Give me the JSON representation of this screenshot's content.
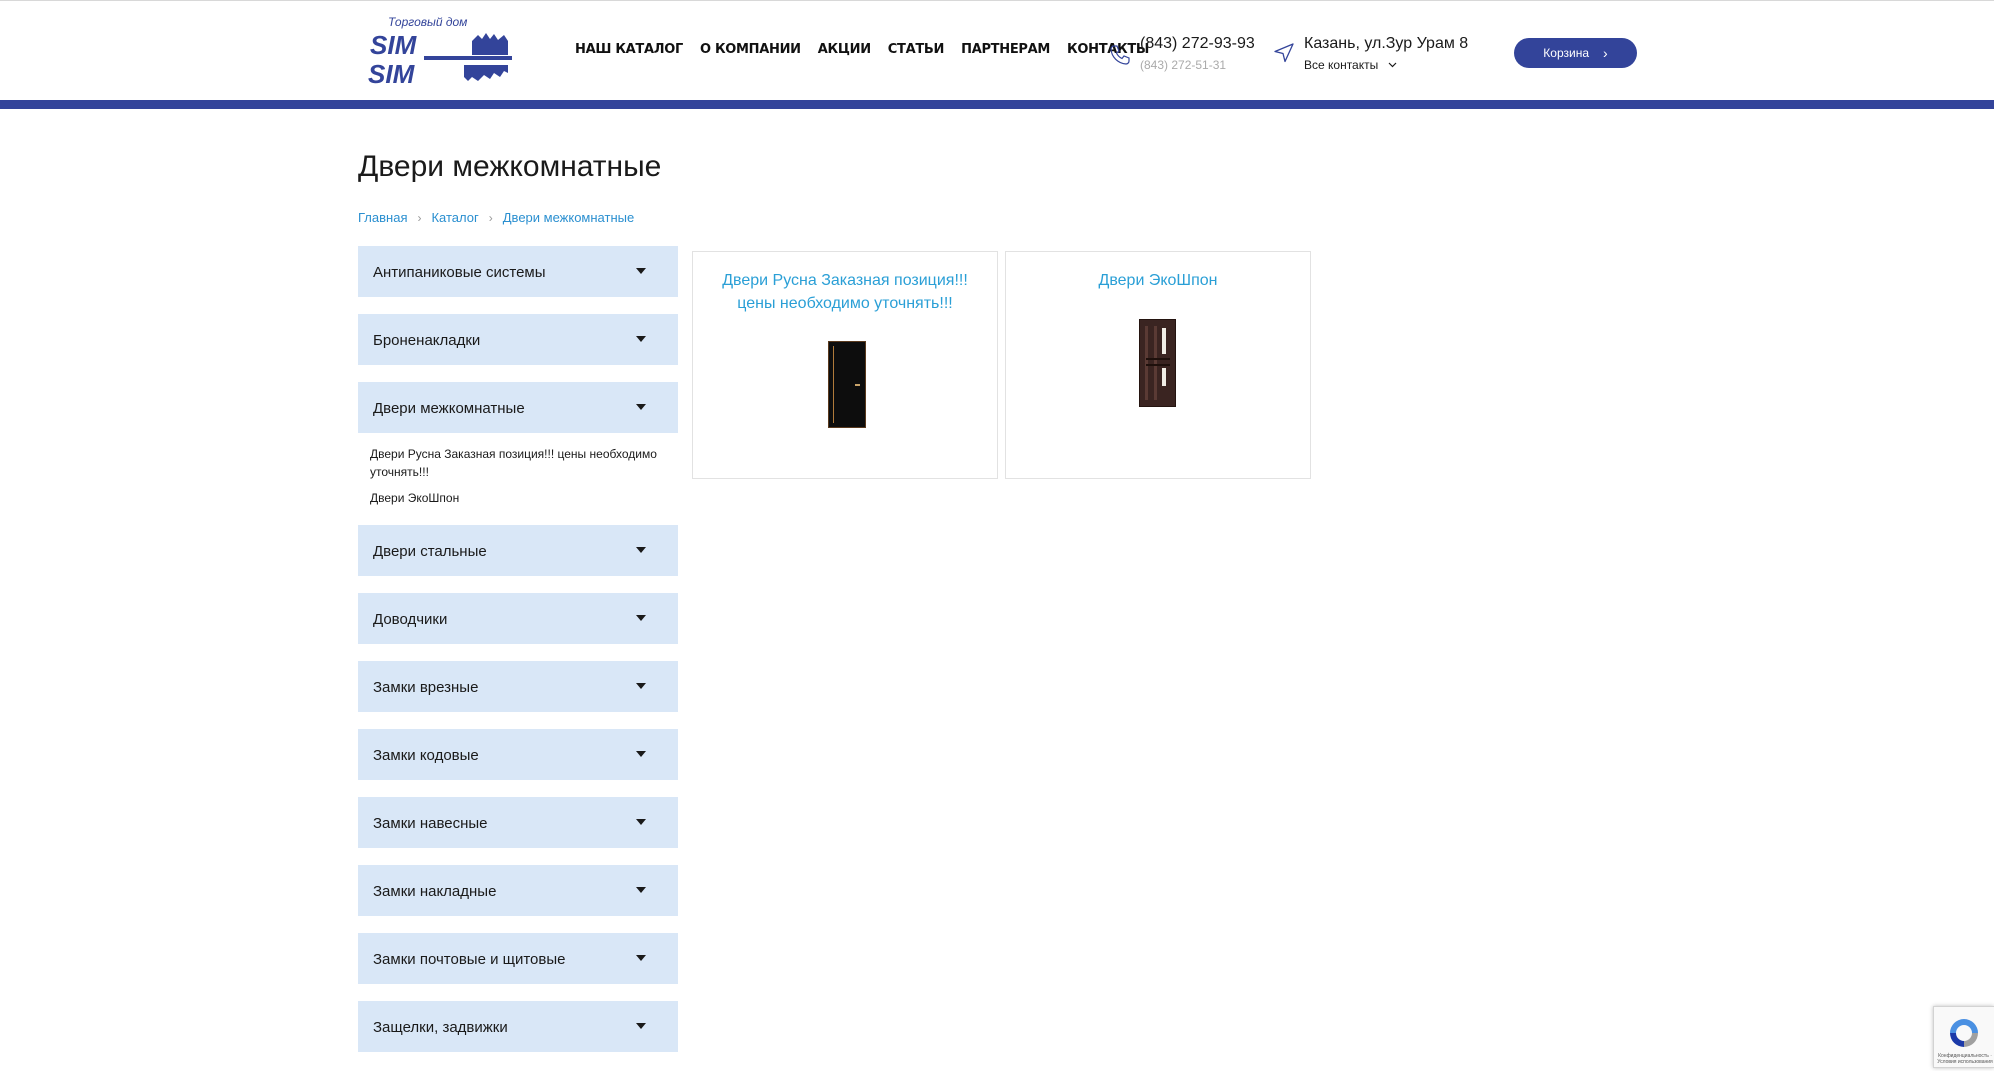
{
  "header": {
    "logo": {
      "tagline": "Торговый дом",
      "brand": "SIM SIM",
      "brand_color": "#33449a"
    },
    "nav": [
      "НАШ КАТАЛОГ",
      "О КОМПАНИИ",
      "АКЦИИ",
      "СТАТЬИ",
      "ПАРТНЕРАМ",
      "КОНТАКТЫ"
    ],
    "phone": {
      "icon": "phone-icon",
      "main": "(843) 272-93-93",
      "secondary": "(843) 272-51-31"
    },
    "address": {
      "icon": "location-arrow-icon",
      "main": "Казань, ул.Зур Урам 8",
      "contacts_link": "Все контакты",
      "chevron_icon": "chevron-down-icon"
    },
    "cart_label": "Корзина",
    "accent_color": "#33449a"
  },
  "page": {
    "title": "Двери межкомнатные",
    "breadcrumb": [
      "Главная",
      "Каталог",
      "Двери межкомнатные"
    ]
  },
  "sidebar": {
    "categories": [
      {
        "label": "Антипаниковые системы"
      },
      {
        "label": "Броненакладки"
      },
      {
        "label": "Двери межкомнатные",
        "expanded": true,
        "subitems": [
          "Двери Русна Заказная позиция!!! цены необходимо уточнять!!!",
          "Двери ЭкоШпон"
        ]
      },
      {
        "label": "Двери стальные"
      },
      {
        "label": "Доводчики"
      },
      {
        "label": "Замки врезные"
      },
      {
        "label": "Замки кодовые"
      },
      {
        "label": "Замки навесные"
      },
      {
        "label": "Замки накладные"
      },
      {
        "label": "Замки почтовые и щитовые"
      },
      {
        "label": "Защелки, задвижки"
      }
    ],
    "category_bg": "#d9e7f7"
  },
  "products": [
    {
      "title": "Двери Русна Заказная позиция!!! цены необходимо уточнять!!!",
      "image": "black-door-image"
    },
    {
      "title": "Двери ЭкоШпон",
      "image": "dark-wood-door-image"
    }
  ],
  "recaptcha": {
    "text": "Конфиденциальность · Условия использования",
    "icon": "recaptcha-icon"
  }
}
